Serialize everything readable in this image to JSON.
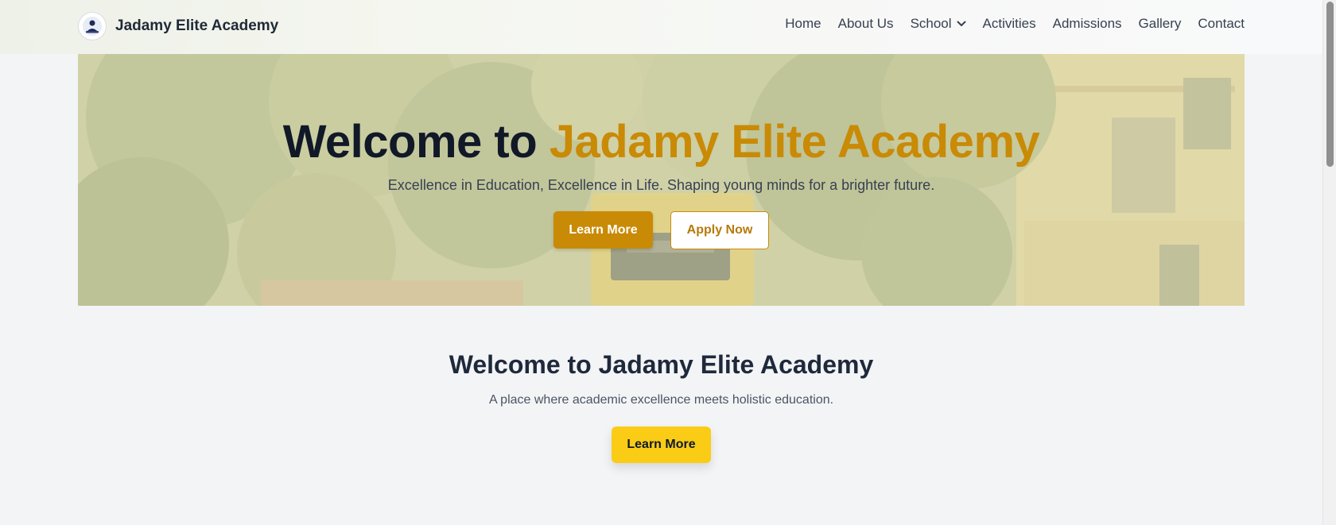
{
  "brand": {
    "name": "Jadamy Elite Academy",
    "logo_icon": "school-crest-icon"
  },
  "nav": {
    "items": [
      {
        "label": "Home"
      },
      {
        "label": "About Us"
      },
      {
        "label": "School",
        "icon": "chevron-down-icon"
      },
      {
        "label": "Activities"
      },
      {
        "label": "Admissions"
      },
      {
        "label": "Gallery"
      },
      {
        "label": "Contact"
      }
    ]
  },
  "hero": {
    "title_prefix": "Welcome to",
    "title_accent": "Jadamy Elite Academy",
    "subtitle": "Excellence in Education, Excellence in Life. Shaping young minds for a brighter future.",
    "primary_button": "Learn More",
    "secondary_button": "Apply Now"
  },
  "welcome": {
    "title": "Welcome to Jadamy Elite Academy",
    "subtitle": "A place where academic excellence meets holistic education.",
    "button": "Learn More"
  },
  "colors": {
    "accent": "#c98a06",
    "cta_yellow": "#facc15",
    "heading": "#111827",
    "background": "#f3f4f6"
  }
}
